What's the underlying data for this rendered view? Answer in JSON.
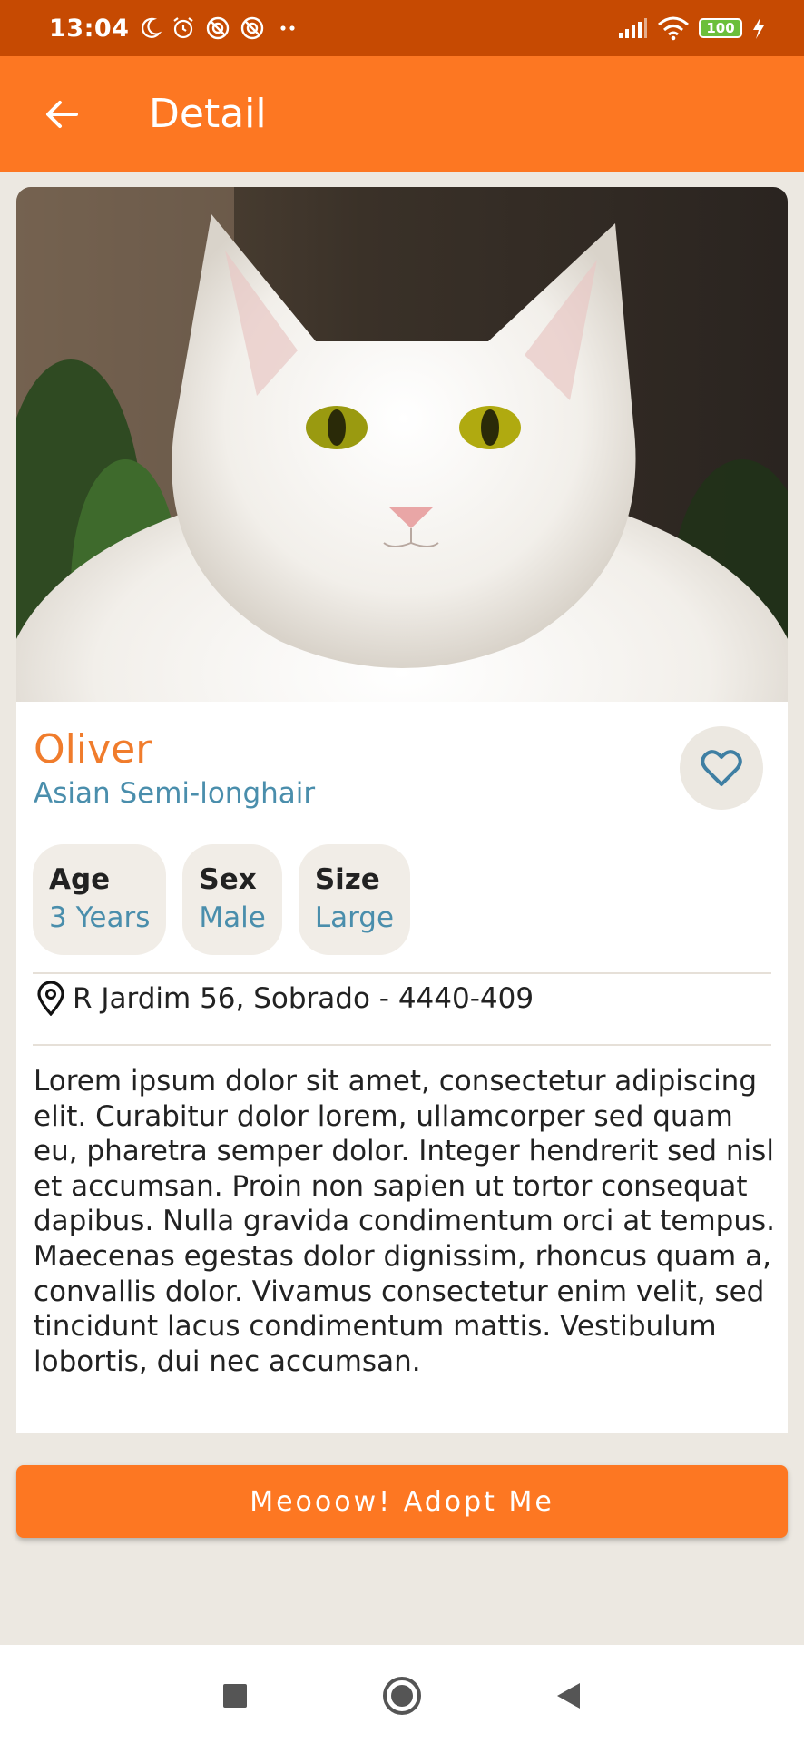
{
  "status_bar": {
    "time": "13:04",
    "battery": "100",
    "left_icons": [
      "moon-icon",
      "alarm-icon",
      "notification-off-icon",
      "notification-off-icon",
      "more-dots-icon"
    ],
    "right_icons": [
      "signal-icon",
      "wifi-icon",
      "battery-icon",
      "charging-icon"
    ]
  },
  "app_bar": {
    "title": "Detail",
    "back_icon": "arrow-left-icon",
    "color": "#fd7722"
  },
  "pet": {
    "name": "Oliver",
    "breed": "Asian Semi-longhair",
    "favorite_icon": "heart-outline-icon",
    "attributes": [
      {
        "label": "Age",
        "value": "3 Years"
      },
      {
        "label": "Sex",
        "value": "Male"
      },
      {
        "label": "Size",
        "value": "Large"
      }
    ],
    "location_icon": "map-pin-icon",
    "location": "R Jardim 56, Sobrado - 4440-409",
    "description": "Lorem ipsum dolor sit amet, consectetur adipiscing elit. Curabitur dolor lorem, ullamcorper sed quam eu, pharetra semper dolor. Integer hendrerit sed nisl et accumsan. Proin non sapien ut tortor consequat dapibus. Nulla gravida condimentum orci at tempus. Maecenas egestas dolor dignissim, rhoncus quam a, convallis dolor. Vivamus consectetur enim velit, sed tincidunt lacus condimentum mattis. Vestibulum lobortis, dui nec accumsan."
  },
  "adopt_button": {
    "label": "Meooow! Adopt Me"
  },
  "nav_bar": {
    "icons": [
      "recents-square-icon",
      "home-circle-icon",
      "back-triangle-icon"
    ]
  },
  "colors": {
    "accent": "#fd7722",
    "status_bar": "#c64a02",
    "name": "#f07c2c",
    "secondary_text": "#4a8eac",
    "background": "#ece8e1"
  }
}
